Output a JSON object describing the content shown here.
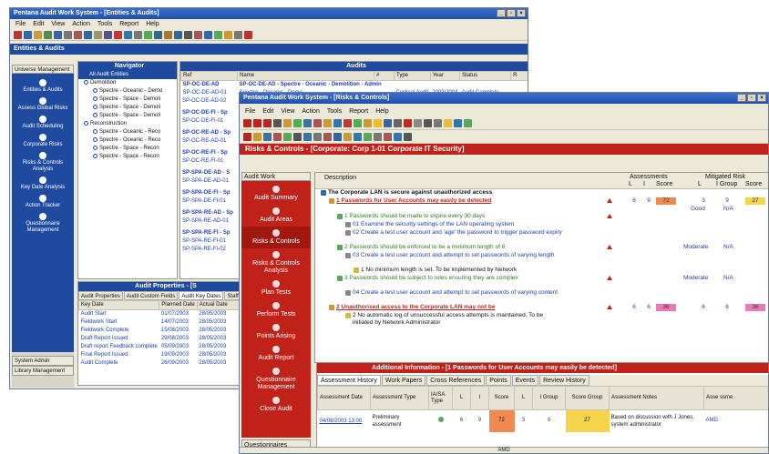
{
  "back": {
    "title": "Pentana Audit Work System - [Entities & Audits]",
    "menu": [
      "File",
      "Edit",
      "View",
      "Action",
      "Tools",
      "Report",
      "Help"
    ],
    "section_title": "Entities & Audits",
    "universe_label": "Universe Management",
    "sidebar": [
      {
        "label": "Entities & Audits"
      },
      {
        "label": "Assess Global Risks"
      },
      {
        "label": "Audit Scheduling"
      },
      {
        "label": "Corporate Risks"
      },
      {
        "label": "Risks & Controls Analysis"
      },
      {
        "label": "Key Date Analysis"
      },
      {
        "label": "Action Tracker"
      },
      {
        "label": "Questionnaire Management"
      }
    ],
    "system_admin": "System Admin",
    "library_mgmt": "Library Management",
    "navigator": {
      "title": "Navigator",
      "root": "All Audit Entities",
      "items": [
        {
          "label": "Demolition",
          "level": 1
        },
        {
          "label": "Spectre - Oceanic - Demo",
          "level": 2
        },
        {
          "label": "Spectre - Space - Demoli",
          "level": 2
        },
        {
          "label": "Spectre - Space - Demoli",
          "level": 2
        },
        {
          "label": "Spectre - Space - Demoli",
          "level": 2
        },
        {
          "label": "Reconstruction",
          "level": 1
        },
        {
          "label": "Spectre - Oceanic - Reco",
          "level": 2
        },
        {
          "label": "Spectre - Oceanic - Reco",
          "level": 2
        },
        {
          "label": "Spectre - Space - Recon",
          "level": 2
        },
        {
          "label": "Spectre - Space - Recon",
          "level": 2
        }
      ]
    },
    "audits": {
      "title": "Audits",
      "columns": [
        "Ref",
        "Name",
        "#",
        "Type",
        "Year",
        "Status",
        "R"
      ],
      "first_row": {
        "ref": "SP-OC-DE-AD",
        "name": "SP-OC-DE-AD - Spectre - Oceanic - Demolition - Admin"
      },
      "second_row": {
        "ref": "SP-OC-DE-AD-01",
        "name": "Spectre - Oceanic - Demo...",
        "type": "Cyclical Audit",
        "year": "2003/2004",
        "status": "Audit Complete"
      },
      "refs": [
        "SP-OC-DE-AD-02",
        "SP-OC-DE-FI - Sp",
        "SP-OC-DE-FI-01",
        "SP-OC-RE-AD - Sp",
        "SP-OC-RE-AD-01",
        "SP-OC-RE-FI - Sp",
        "SP-OC-RE-FI-01",
        "SP-SPA-DE-AD - S",
        "SP-SPA-DE-AD-01",
        "SP-SPA-DE-FI - Sp",
        "SP-SPA-DE-FI-01",
        "SP-SPA-RE-AD - Sp",
        "SP-SPA-RE-AD-01",
        "SP-SPA-RE-FI - Sp",
        "SP-SPA-RE-FI-01",
        "SP-SPA-RE-FI-02"
      ]
    },
    "props": {
      "title": "Audit Properties - [S",
      "tabs": [
        "Audit Properties",
        "Audit Custom Fields",
        "Audit Key Dates",
        "Staff"
      ],
      "columns": [
        "Key Date",
        "Planned Date",
        "Actual Date"
      ],
      "rows": [
        {
          "k": "Audit Start",
          "p": "01/07/2003",
          "a": "28/05/2003"
        },
        {
          "k": "Fieldwork Start",
          "p": "14/07/2003",
          "a": "28/05/2003"
        },
        {
          "k": "Fieldwork Complete",
          "p": "15/08/2003",
          "a": "28/05/2003"
        },
        {
          "k": "Draft Report Issued",
          "p": "29/08/2003",
          "a": "28/05/2003"
        },
        {
          "k": "Draft report Feedback complete",
          "p": "05/09/2003",
          "a": "28/05/2003"
        },
        {
          "k": "Final Report Issued",
          "p": "19/09/2003",
          "a": "28/05/2003"
        },
        {
          "k": "Audit Complete",
          "p": "26/09/2003",
          "a": "28/05/2003"
        }
      ]
    }
  },
  "front": {
    "title": "Pentana Audit Work System - [Risks & Controls]",
    "menu": [
      "File",
      "Edit",
      "View",
      "Action",
      "Tools",
      "Report",
      "Help"
    ],
    "header": "Risks & Controls - [Corporate: Corp 1-01  Corporate IT Security]",
    "audit_work_label": "Audit Work",
    "questionnaires_label": "Questionnaires",
    "sidebar": [
      {
        "label": "Audit Summary"
      },
      {
        "label": "Audit Areas"
      },
      {
        "label": "Risks & Controls"
      },
      {
        "label": "Risks & Controls Analysis"
      },
      {
        "label": "Plan Tests"
      },
      {
        "label": "Perform Tests"
      },
      {
        "label": "Points Arising"
      },
      {
        "label": "Audit Report"
      },
      {
        "label": "Questionnaire Management"
      },
      {
        "label": "Close Audit"
      }
    ],
    "tree_header": {
      "description": "Description",
      "assessments": "Assessments",
      "mitigated": "Mitigated Risk",
      "L": "L",
      "I": "I",
      "score": "Score",
      "igroup": "I Group"
    },
    "tree": [
      {
        "text": "The Corporate LAN is secure against unauthorized access",
        "cls": "",
        "indent": 0
      },
      {
        "text": "1 Passwords for User Accounts may easily be detected",
        "cls": "red",
        "indent": 1,
        "l": "6",
        "i": "9",
        "score": "72",
        "ml": "3",
        "mg": "9",
        "ms": "27",
        "good": "Good",
        "na": "N/A"
      },
      {
        "text": "1 Passwords should be made to expire every 30 days",
        "cls": "green",
        "indent": 2
      },
      {
        "text": "01 Examine the security settings of the LAN operating system",
        "cls": "blue",
        "indent": 3
      },
      {
        "text": "02 Create a test user account and 'age' the password to trigger password expiry",
        "cls": "blue",
        "indent": 3
      },
      {
        "text": "2 Passwords should be enforced to be a minimum length of 6",
        "cls": "green",
        "indent": 2,
        "mod": "Moderate",
        "na": "N/A"
      },
      {
        "text": "03 Create a test user account and attempt to set passwords of varying length",
        "cls": "blue",
        "indent": 3
      },
      {
        "text": "1 No minimum length is set. To be implemented by Network",
        "cls": "",
        "indent": 4
      },
      {
        "text": "3 Passwords should be subject to rules ensuring they are complex",
        "cls": "green",
        "indent": 2,
        "mod": "Moderate",
        "na": "N/A"
      },
      {
        "text": "04 Create a test user account and attempt to set passwords of varying content",
        "cls": "blue",
        "indent": 3
      },
      {
        "text": "2 Unauthorised access to the Corporate LAN may not be",
        "cls": "red",
        "indent": 1,
        "l": "6",
        "i": "6",
        "score": "36",
        "ml": "6",
        "mg": "6",
        "ms": "36"
      },
      {
        "text": "2 No automatic log of unsuccessful access attempts is maintained. To be initiated by Network Administrator",
        "cls": "",
        "indent": 3
      }
    ],
    "info": {
      "title": "Additional Information - [1 Passwords for User Accounts may easily be detected]",
      "tabs": [
        "Assessment History",
        "Work Papers",
        "Cross References",
        "Points",
        "Events",
        "Review History"
      ],
      "columns": [
        "Assessment Date",
        "Assessment Type",
        "IA/SA Type",
        "L",
        "I",
        "Score",
        "L",
        "I Group",
        "Score Group",
        "Assessment Notes",
        "Asse ssme"
      ],
      "row": {
        "date": "04/06/2003 13:00",
        "type": "Preliminary assessment",
        "l": "6",
        "i": "9",
        "score": "72",
        "ml": "3",
        "ig": "9",
        "sg": "27",
        "notes": "Based on discussion with J Jones, system administrator",
        "by": "AMD"
      }
    },
    "status": "AMD"
  },
  "colors": {
    "navy": "#1e4aa0",
    "red": "#c0221a",
    "score_orange": "#f08a50",
    "score_yellow": "#f5d34a",
    "score_pink": "#e87ab4"
  }
}
